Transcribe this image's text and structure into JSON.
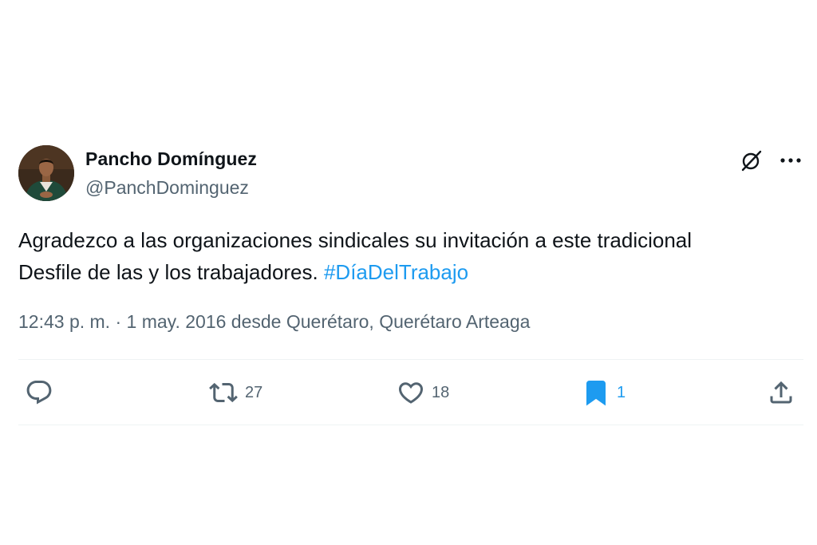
{
  "author": {
    "name": "Pancho Domínguez",
    "handle": "@PanchDominguez"
  },
  "tweet": {
    "text_before": "Agradezco a las organizaciones sindicales su invitación a este tradicional Desfile de las y los trabajadores. ",
    "hashtag": "#DíaDelTrabajo",
    "time": "12:43 p. m.",
    "separator": " · ",
    "date": "1 may. 2016",
    "source_prefix": " desde ",
    "location": "Querétaro, Querétaro Arteaga"
  },
  "actions": {
    "reply": {
      "icon": "reply-icon",
      "count": ""
    },
    "retweet": {
      "icon": "retweet-icon",
      "count": "27"
    },
    "like": {
      "icon": "heart-icon",
      "count": "18"
    },
    "bookmark": {
      "icon": "bookmark-icon",
      "count": "1",
      "active": true
    },
    "share": {
      "icon": "share-icon",
      "count": ""
    }
  },
  "icons": {
    "grok": "grok-icon",
    "more": "more-icon"
  },
  "colors": {
    "text": "#0f1419",
    "secondary": "#536471",
    "accent": "#1d9bf0",
    "divider": "#eff3f4"
  }
}
